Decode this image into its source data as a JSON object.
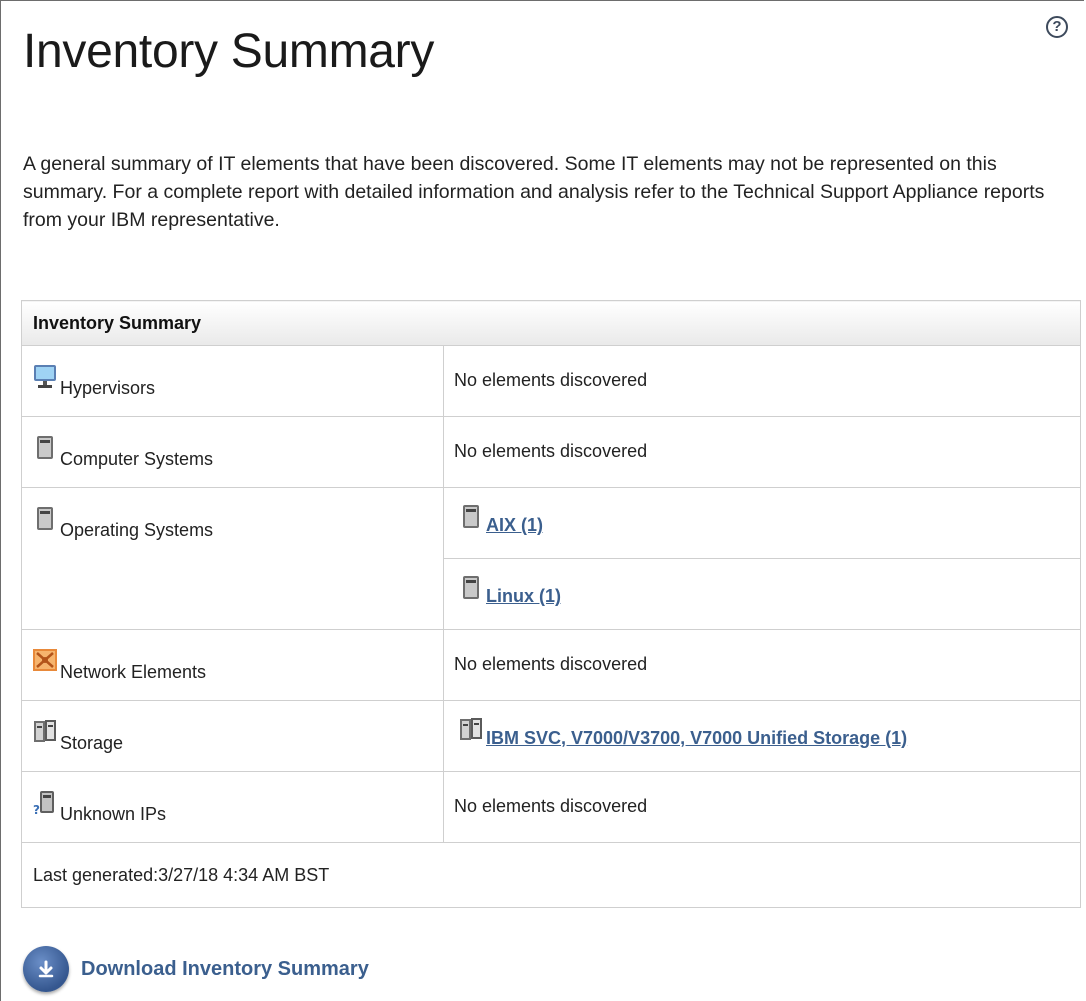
{
  "page": {
    "title": "Inventory Summary",
    "help_icon": "help-icon",
    "description": "A general summary of IT elements that have been discovered. Some IT elements may not be represented on this summary. For a complete report with detailed information and analysis refer to the Technical Support Appliance reports from your IBM representative."
  },
  "table": {
    "header": "Inventory Summary",
    "rows": [
      {
        "category": "Hypervisors",
        "icon": "monitor-icon",
        "value": "No elements discovered"
      },
      {
        "category": "Computer Systems",
        "icon": "server-icon",
        "value": "No elements discovered"
      },
      {
        "category": "Operating Systems",
        "icon": "server-icon",
        "links": [
          {
            "label": "AIX (1)",
            "icon": "server-icon"
          },
          {
            "label": "Linux (1)",
            "icon": "server-icon"
          }
        ]
      },
      {
        "category": "Network Elements",
        "icon": "network-icon",
        "value": "No elements discovered"
      },
      {
        "category": "Storage",
        "icon": "storage-icon",
        "links": [
          {
            "label": "IBM SVC, V7000/V3700, V7000 Unified Storage (1)",
            "icon": "storage-icon"
          }
        ]
      },
      {
        "category": "Unknown IPs",
        "icon": "unknown-device-icon",
        "value": "No elements discovered"
      }
    ],
    "footer": "Last generated:3/27/18 4:34 AM BST"
  },
  "download": {
    "label": "Download Inventory Summary",
    "icon": "download-icon"
  },
  "colors": {
    "link": "#3b5f8e",
    "border": "#cfcfcf",
    "download_button": "#35578f"
  }
}
